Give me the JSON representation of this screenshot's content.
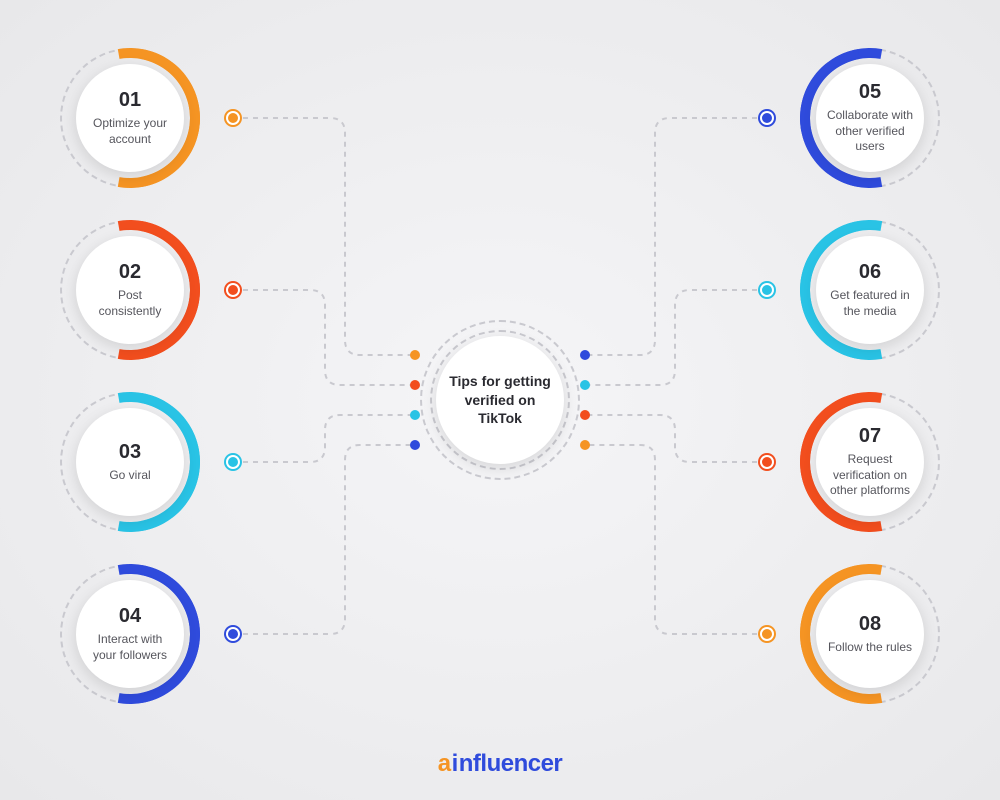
{
  "hub": {
    "title": "Tips for getting verified on TikTok"
  },
  "colors": {
    "orange": "#f59423",
    "red": "#f24e1e",
    "cyan": "#29c3e5",
    "blue": "#2f4bdc"
  },
  "left": [
    {
      "num": "01",
      "label": "Optimize your account",
      "color": "orange"
    },
    {
      "num": "02",
      "label": "Post consistently",
      "color": "red"
    },
    {
      "num": "03",
      "label": "Go viral",
      "color": "cyan"
    },
    {
      "num": "04",
      "label": "Interact with your followers",
      "color": "blue"
    }
  ],
  "right": [
    {
      "num": "05",
      "label": "Collaborate with other verified users",
      "color": "blue"
    },
    {
      "num": "06",
      "label": "Get featured in the media",
      "color": "cyan"
    },
    {
      "num": "07",
      "label": "Request verification on other platforms",
      "color": "red"
    },
    {
      "num": "08",
      "label": "Follow the rules",
      "color": "orange"
    }
  ],
  "logo": {
    "a": "a",
    "i": "i",
    "rest": "nfluencer"
  }
}
